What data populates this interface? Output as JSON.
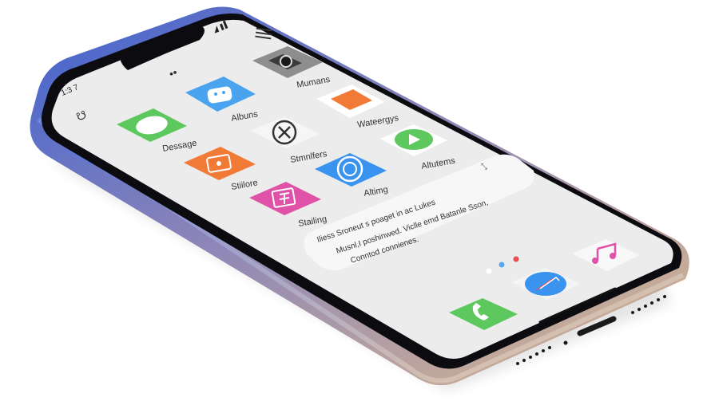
{
  "device": {
    "status_time": "1:3 7",
    "top_dots": "••",
    "side_glyph": "☋"
  },
  "apps": {
    "camera_label": "Mumans",
    "contacts_label": "Albuns",
    "wallet_label": "Wateergys",
    "messages_label": "Dessage",
    "close_app_label": "Stmnlfers",
    "play_app_label": "Altutems",
    "photo_app_label": "Stiilore",
    "search_app_label": "Altimg",
    "notes_app_label": "Stailing"
  },
  "widget": {
    "text_lines": [
      "Iliess Sroneut s poaget in ac Lukes",
      "Musnl,I poshinwed. Viclle emd Batanle Sson,",
      "Conntod connienes."
    ]
  },
  "page_dots": {
    "colors": [
      "#ffffff",
      "#5aa9f0",
      "#f04a52"
    ]
  },
  "colors": {
    "frame_top": "#4a6fd8",
    "frame_bottom": "#d6b48a",
    "screen_bg": "#ececec",
    "phone_green": "#58c85a",
    "orange": "#f07a36",
    "blue": "#3a93ee",
    "pink": "#e052a8"
  }
}
